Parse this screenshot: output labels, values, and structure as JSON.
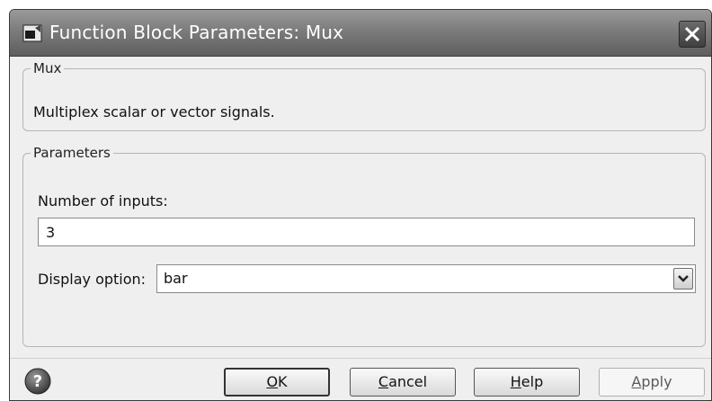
{
  "window": {
    "title": "Function Block Parameters: Mux"
  },
  "icons": {
    "app": "simulink-block-icon",
    "close": "close-icon",
    "help": "help-question-icon",
    "dropdown": "chevron-down-icon"
  },
  "mux_section": {
    "legend": "Mux",
    "description": "Multiplex scalar or vector signals."
  },
  "parameters_section": {
    "legend": "Parameters",
    "number_of_inputs": {
      "label": "Number of inputs:",
      "value": "3"
    },
    "display_option": {
      "label": "Display option:",
      "value": "bar"
    }
  },
  "buttons": {
    "ok": {
      "mnemonic": "O",
      "rest": "K"
    },
    "cancel": {
      "mnemonic": "C",
      "rest": "ancel"
    },
    "help": {
      "mnemonic": "H",
      "rest": "elp"
    },
    "apply": {
      "mnemonic": "A",
      "rest": "pply",
      "enabled": false
    }
  }
}
